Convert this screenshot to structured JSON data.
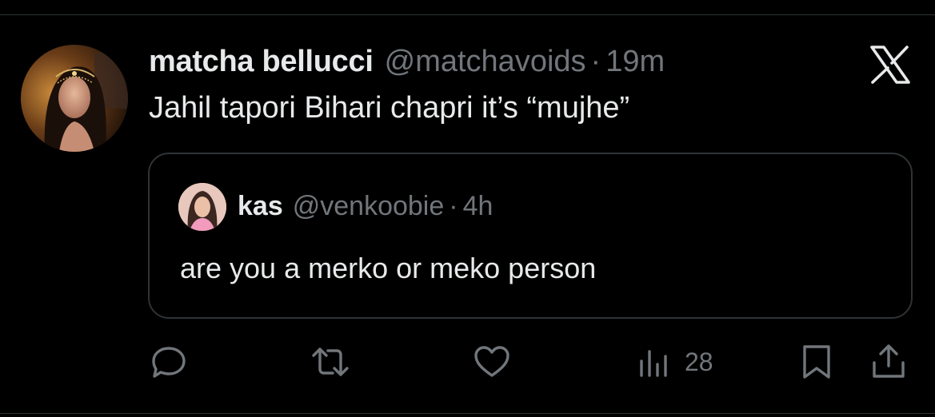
{
  "tweet": {
    "display_name": "matcha bellucci",
    "handle": "@matchavoids",
    "separator": "·",
    "time": "19m",
    "text": "Jahil tapori Bihari chapri it’s “mujhe”"
  },
  "quoted_tweet": {
    "display_name": "kas",
    "handle": "@venkoobie",
    "separator": "·",
    "time": "4h",
    "text": "are you a merko or meko person"
  },
  "actions": {
    "reply_icon": "reply-icon",
    "retweet_icon": "retweet-icon",
    "like_icon": "heart-icon",
    "views_icon": "bar-chart-icon",
    "views_count": "28",
    "bookmark_icon": "bookmark-icon",
    "share_icon": "share-icon"
  },
  "brand": {
    "logo": "x-logo-icon"
  },
  "colors": {
    "background": "#000000",
    "primary_text": "#e7e9ea",
    "secondary_text": "#71767b",
    "border": "#2f3336"
  }
}
